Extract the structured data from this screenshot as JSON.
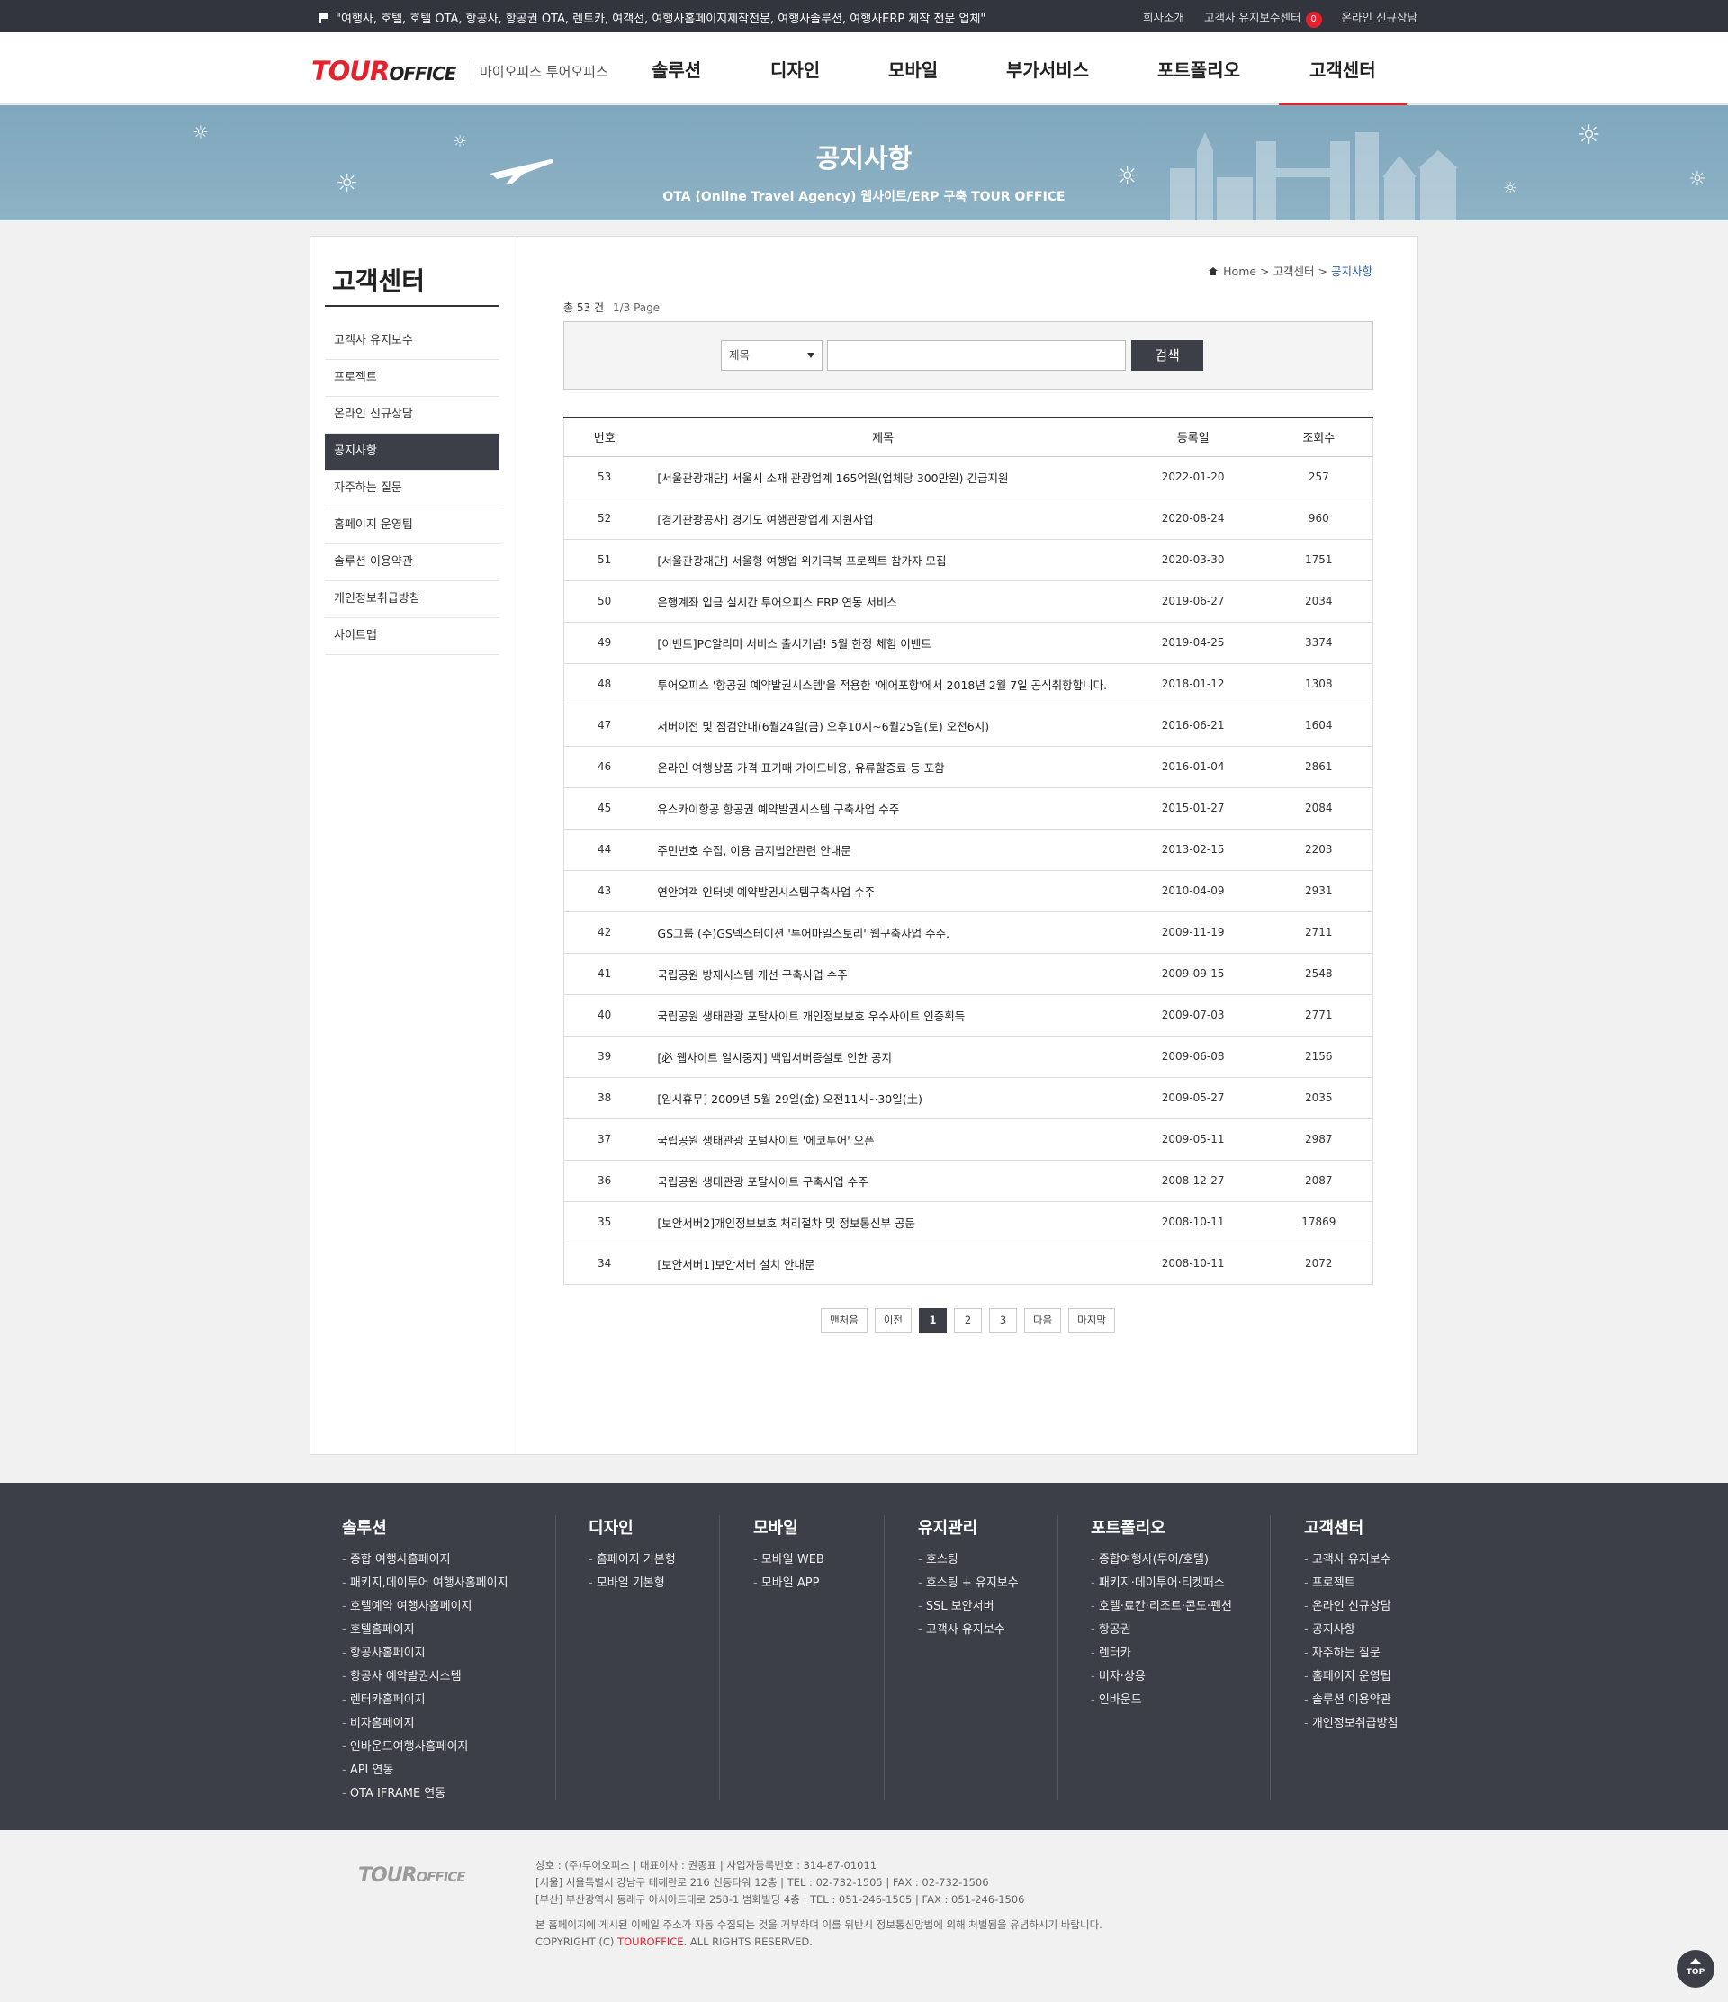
{
  "topbar": {
    "notice": "\"여행사, 호텔, 호텔 OTA, 항공사, 항공권 OTA, 렌트카, 여객선, 여행사홈페이지제작전문, 여행사솔루션, 여행사ERP 제작 전문 업체\"",
    "links": [
      "회사소개",
      "고객사 유지보수센터",
      "온라인 신규상담"
    ],
    "badge": "0"
  },
  "header": {
    "logo_tour": "TOUR",
    "logo_office": "OFFICE",
    "logo_sub": "마이오피스 투어오피스",
    "nav": [
      "솔루션",
      "디자인",
      "모바일",
      "부가서비스",
      "포트폴리오",
      "고객센터"
    ],
    "active_nav": "고객센터"
  },
  "banner": {
    "title": "공지사항",
    "subtitle": "OTA (Online Travel Agency) 웹사이트/ERP 구축 TOUR OFFICE"
  },
  "lnb": {
    "title": "고객센터",
    "items": [
      "고객사 유지보수",
      "프로젝트",
      "온라인 신규상담",
      "공지사항",
      "자주하는 질문",
      "홈페이지 운영팁",
      "솔루션 이용약관",
      "개인정보취급방침",
      "사이트맵"
    ],
    "active": "공지사항"
  },
  "breadcrumb": {
    "home": "Home",
    "sep": ">",
    "level1": "고객센터",
    "current": "공지사항"
  },
  "summary": {
    "total": "총 53 건",
    "page": "1/3 Page"
  },
  "search": {
    "select_value": "제목",
    "input_value": "",
    "button": "검색"
  },
  "board": {
    "headers": [
      "번호",
      "제목",
      "등록일",
      "조회수"
    ],
    "rows": [
      {
        "no": "53",
        "title": "[서울관광재단] 서울시 소재 관광업계 165억원(업체당 300만원) 긴급지원",
        "date": "2022-01-20",
        "views": "257"
      },
      {
        "no": "52",
        "title": "[경기관광공사] 경기도 여행관광업계 지원사업",
        "date": "2020-08-24",
        "views": "960"
      },
      {
        "no": "51",
        "title": "[서울관광재단] 서울형 여행업 위기극복 프로젝트 참가자 모집",
        "date": "2020-03-30",
        "views": "1751"
      },
      {
        "no": "50",
        "title": "은행계좌 입금 실시간 투어오피스 ERP 연동 서비스",
        "date": "2019-06-27",
        "views": "2034"
      },
      {
        "no": "49",
        "title": "[이벤트]PC알리미 서비스 출시기념! 5월 한정 체험 이벤트",
        "date": "2019-04-25",
        "views": "3374"
      },
      {
        "no": "48",
        "title": "투어오피스 '항공권 예약발권시스템'을 적용한 '에어포항'에서 2018년 2월 7일 공식취항합니다.",
        "date": "2018-01-12",
        "views": "1308"
      },
      {
        "no": "47",
        "title": "서버이전 및 점검안내(6월24일(금) 오후10시~6월25일(토) 오전6시)",
        "date": "2016-06-21",
        "views": "1604"
      },
      {
        "no": "46",
        "title": "온라인 여행상품 가격 표기때 가이드비용, 유류할증료 등 포함",
        "date": "2016-01-04",
        "views": "2861"
      },
      {
        "no": "45",
        "title": "유스카이항공 항공권 예약발권시스템 구축사업 수주",
        "date": "2015-01-27",
        "views": "2084"
      },
      {
        "no": "44",
        "title": "주민번호 수집, 이용 금지법안관련 안내문",
        "date": "2013-02-15",
        "views": "2203"
      },
      {
        "no": "43",
        "title": "연안여객 인터넷 예약발권시스템구축사업 수주",
        "date": "2010-04-09",
        "views": "2931"
      },
      {
        "no": "42",
        "title": "GS그룹 (주)GS넥스테이션 '투어마일스토리' 웹구축사업 수주.",
        "date": "2009-11-19",
        "views": "2711"
      },
      {
        "no": "41",
        "title": "국립공원 방재시스템 개선 구축사업 수주",
        "date": "2009-09-15",
        "views": "2548"
      },
      {
        "no": "40",
        "title": "국립공원 생태관광 포탈사이트 개인정보보호 우수사이트 인증획득",
        "date": "2009-07-03",
        "views": "2771"
      },
      {
        "no": "39",
        "title": "[必 웹사이트 일시중지] 백업서버증설로 인한 공지",
        "date": "2009-06-08",
        "views": "2156"
      },
      {
        "no": "38",
        "title": "[임시휴무] 2009년 5월 29일(金) 오전11시~30일(土)",
        "date": "2009-05-27",
        "views": "2035"
      },
      {
        "no": "37",
        "title": "국립공원 생태관광 포털사이트 '에코투어' 오픈",
        "date": "2009-05-11",
        "views": "2987"
      },
      {
        "no": "36",
        "title": "국립공원 생태관광 포탈사이트 구축사업 수주",
        "date": "2008-12-27",
        "views": "2087"
      },
      {
        "no": "35",
        "title": "[보안서버2]개인정보보호 처리절차 및 정보통신부 공문",
        "date": "2008-10-11",
        "views": "17869"
      },
      {
        "no": "34",
        "title": "[보안서버1]보안서버 설치 안내문",
        "date": "2008-10-11",
        "views": "2072"
      }
    ]
  },
  "paging": {
    "first": "맨처음",
    "prev": "이전",
    "pages": [
      "1",
      "2",
      "3"
    ],
    "current": "1",
    "next": "다음",
    "last": "마지막"
  },
  "footer_sitemap": [
    {
      "title": "솔루션",
      "items": [
        "종합 여행사홈페이지",
        "패키지,데이투어 여행사홈페이지",
        "호텔예약 여행사홈페이지",
        "호텔홈페이지",
        "항공사홈페이지",
        "항공사 예약발권시스템",
        "렌터카홈페이지",
        "비자홈페이지",
        "인바운드여행사홈페이지",
        "API 연동",
        "OTA IFRAME 연동"
      ]
    },
    {
      "title": "디자인",
      "items": [
        "홈페이지 기본형",
        "모바일 기본형"
      ]
    },
    {
      "title": "모바일",
      "items": [
        "모바일 WEB",
        "모바일 APP"
      ]
    },
    {
      "title": "유지관리",
      "items": [
        "호스팅",
        "호스팅 + 유지보수",
        "SSL 보안서버",
        "고객사 유지보수"
      ]
    },
    {
      "title": "포트폴리오",
      "items": [
        "종합여행사(투어/호텔)",
        "패키지·데이투어·티켓패스",
        "호텔·료칸·리조트·콘도·펜션",
        "항공권",
        "렌터카",
        "비자·상용",
        "인바운드"
      ]
    },
    {
      "title": "고객센터",
      "items": [
        "고객사 유지보수",
        "프로젝트",
        "온라인 신규상담",
        "공지사항",
        "자주하는 질문",
        "홈페이지 운영팁",
        "솔루션 이용약관",
        "개인정보취급방침"
      ]
    }
  ],
  "footer": {
    "logo_tour": "TOUR",
    "logo_office": "OFFICE",
    "line1": "상호 : (주)투어오피스  |  대표이사 : 권종표  |  사업자등록번호 : 314-87-01011",
    "line2": "[서울] 서울특별시 강남구 테헤란로 216 신동타워 12층  |  TEL : 02-732-1505  |  FAX : 02-732-1506",
    "line3": "[부산] 부산광역시 동래구 아시아드대로 258-1 범화빌딩 4층  |  TEL : 051-246-1505  |  FAX : 051-246-1506",
    "line4": "본 홈페이지에 게시된 이메일 주소가 자동 수집되는 것을 거부하며 이를 위반시 정보통신망법에 의해 처벌됨을 유념하시기 바랍니다.",
    "copyright_pre": "COPYRIGHT (C)",
    "copyright_brand": "TOUROFFICE",
    "copyright_post": ". ALL RIGHTS RESERVED.",
    "top_button": "TOP"
  }
}
